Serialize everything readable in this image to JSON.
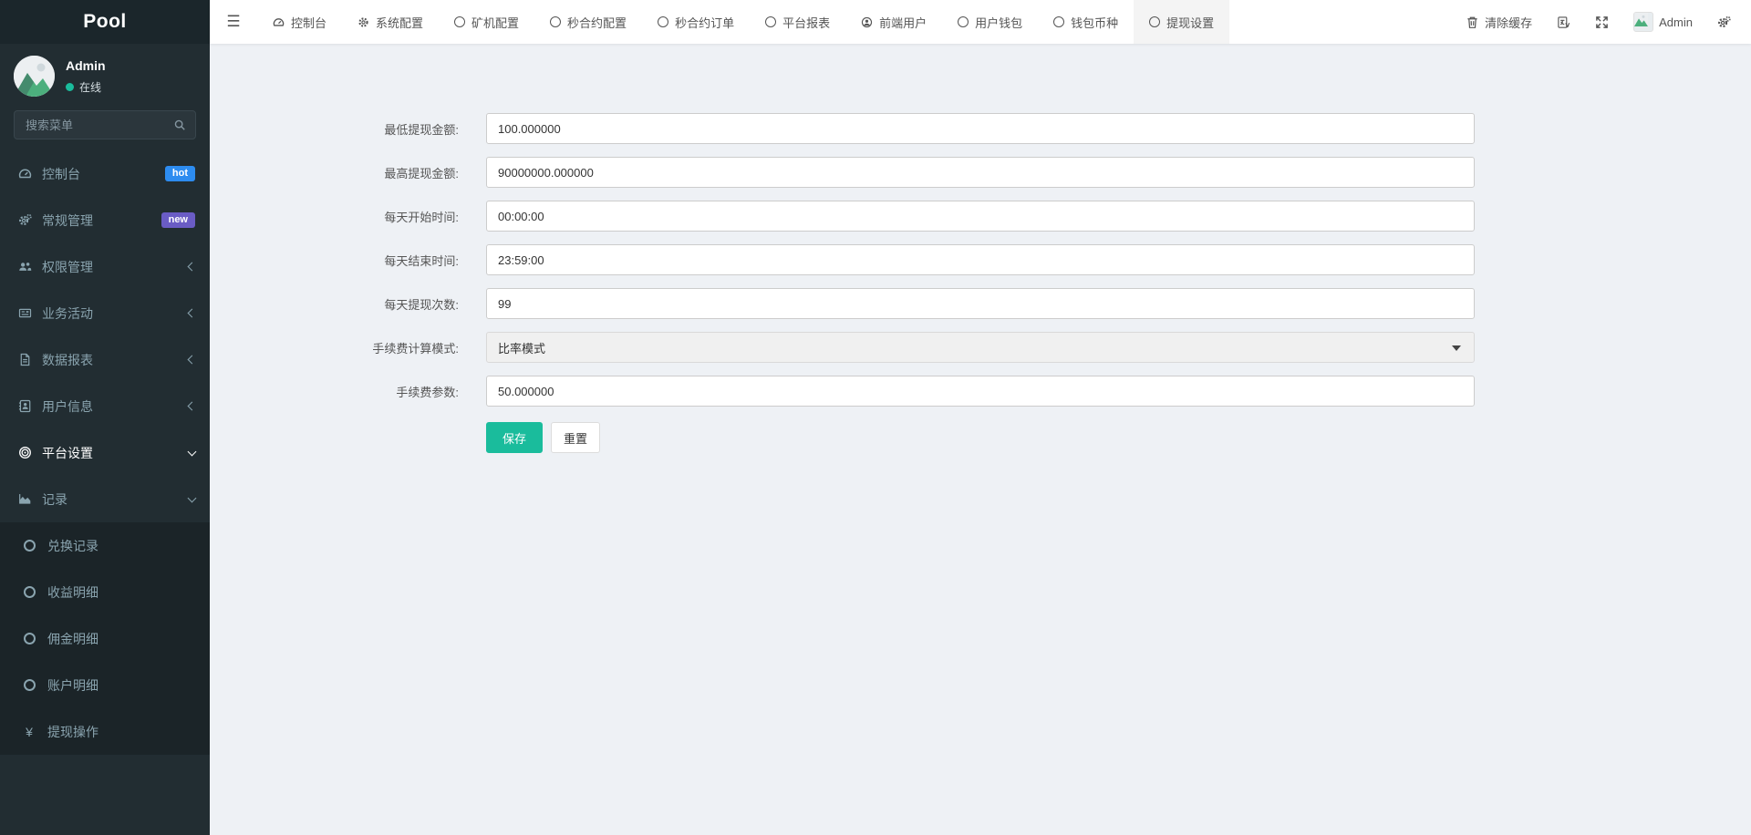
{
  "app": {
    "logo_text": "Pool"
  },
  "sidebar": {
    "user": {
      "name": "Admin",
      "status": "在线"
    },
    "search": {
      "placeholder": "搜索菜单"
    },
    "menu": [
      {
        "label": "控制台",
        "icon": "dashboard-icon",
        "badge": "hot"
      },
      {
        "label": "常规管理",
        "icon": "cogs-icon",
        "badge": "new"
      },
      {
        "label": "权限管理",
        "icon": "users-icon"
      },
      {
        "label": "业务活动",
        "icon": "newspaper-icon"
      },
      {
        "label": "数据报表",
        "icon": "report-icon"
      },
      {
        "label": "用户信息",
        "icon": "contacts-icon"
      },
      {
        "label": "平台设置",
        "icon": "bullseye-icon"
      },
      {
        "label": "记录",
        "icon": "chart-icon"
      }
    ],
    "submenu": [
      {
        "label": "兑换记录",
        "icon": "circle-icon"
      },
      {
        "label": "收益明细",
        "icon": "circle-icon"
      },
      {
        "label": "佣金明细",
        "icon": "circle-icon"
      },
      {
        "label": "账户明细",
        "icon": "circle-icon"
      },
      {
        "label": "提现操作",
        "icon": "yen-icon",
        "icon_glyph": "¥"
      }
    ]
  },
  "topbar": {
    "tabs": [
      {
        "label": "控制台",
        "icon": "dashboard-icon"
      },
      {
        "label": "系统配置",
        "icon": "gear-icon"
      },
      {
        "label": "矿机配置",
        "icon": "circle-icon"
      },
      {
        "label": "秒合约配置",
        "icon": "circle-icon"
      },
      {
        "label": "秒合约订单",
        "icon": "circle-icon"
      },
      {
        "label": "平台报表",
        "icon": "circle-icon"
      },
      {
        "label": "前端用户",
        "icon": "user-circle-icon"
      },
      {
        "label": "用户钱包",
        "icon": "circle-icon"
      },
      {
        "label": "钱包币种",
        "icon": "circle-icon"
      },
      {
        "label": "提现设置",
        "icon": "circle-icon"
      }
    ],
    "active_tab": "提现设置",
    "hamburger_glyph": "☰",
    "clear_cache_label": "清除缓存",
    "username": "Admin"
  },
  "form": {
    "fields": [
      {
        "label": "最低提现金额:",
        "value": "100.000000",
        "type": "input"
      },
      {
        "label": "最高提现金额:",
        "value": "90000000.000000",
        "type": "input"
      },
      {
        "label": "每天开始时间:",
        "value": "00:00:00",
        "type": "input"
      },
      {
        "label": "每天结束时间:",
        "value": "23:59:00",
        "type": "input"
      },
      {
        "label": "每天提现次数:",
        "value": "99",
        "type": "input"
      },
      {
        "label": "手续费计算模式:",
        "value": "比率模式",
        "type": "select"
      },
      {
        "label": "手续费参数:",
        "value": "50.000000",
        "type": "input"
      }
    ],
    "save_label": "保存",
    "reset_label": "重置"
  },
  "colors": {
    "sidebar_bg": "#222d32",
    "submenu_bg": "#1b2428",
    "logo_bg": "#1b262b",
    "sidebar_text": "#8aa4af",
    "accent_green": "#1abc9c",
    "online_dot": "#1abc9c",
    "badge_hot": "#2d8cf0",
    "badge_new": "#6a5cc5",
    "content_bg": "#eef1f5",
    "header_bg": "#ffffff",
    "active_tab_bg": "#f4f4f4"
  }
}
